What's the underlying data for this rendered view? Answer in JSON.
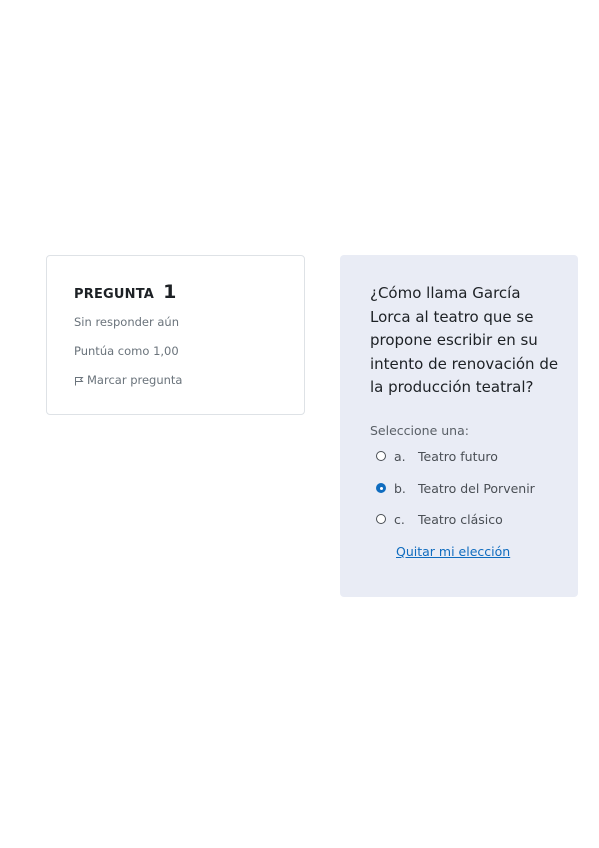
{
  "info": {
    "label": "PREGUNTA",
    "number": "1",
    "status": "Sin responder aún",
    "grade": "Puntúa como 1,00",
    "flag_label": "Marcar pregunta",
    "flag_icon": "flag-icon"
  },
  "question": {
    "text": "¿Cómo llama García Lorca al teatro que se propone escribir en su intento de renovación de la producción teatral?",
    "prompt": "Seleccione una:",
    "options": [
      {
        "letter": "a.",
        "text": "Teatro futuro",
        "selected": false
      },
      {
        "letter": "b.",
        "text": "Teatro del Porvenir",
        "selected": true
      },
      {
        "letter": "c.",
        "text": "Teatro clásico",
        "selected": false
      }
    ],
    "clear_label": "Quitar mi elección"
  },
  "colors": {
    "card_bg": "#e9ecf5",
    "accent": "#0f6cbf",
    "muted_text": "#6a737b"
  }
}
